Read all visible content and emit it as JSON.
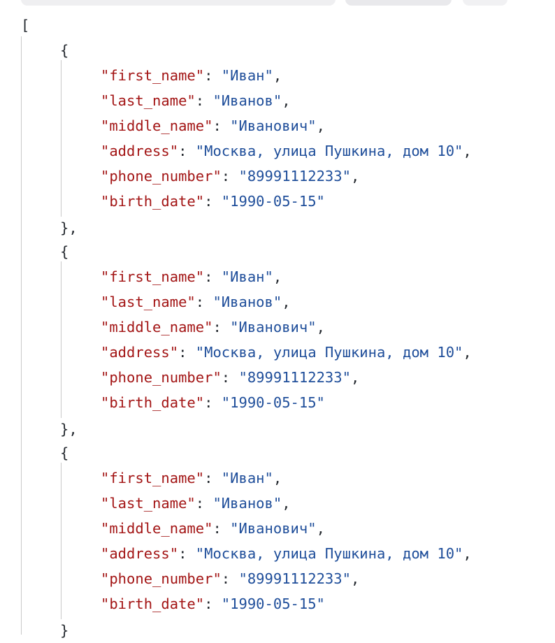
{
  "tabs": [
    "",
    "",
    ""
  ],
  "json": {
    "open_bracket": "[",
    "records": [
      {
        "open": "{",
        "close": "},",
        "fields": [
          {
            "key": "\"first_name\"",
            "value": "\"Иван\"",
            "trail": ","
          },
          {
            "key": "\"last_name\"",
            "value": "\"Иванов\"",
            "trail": ","
          },
          {
            "key": "\"middle_name\"",
            "value": "\"Иванович\"",
            "trail": ","
          },
          {
            "key": "\"address\"",
            "value": "\"Москва, улица Пушкина, дом 10\"",
            "trail": ","
          },
          {
            "key": "\"phone_number\"",
            "value": "\"89991112233\"",
            "trail": ","
          },
          {
            "key": "\"birth_date\"",
            "value": "\"1990-05-15\"",
            "trail": ""
          }
        ]
      },
      {
        "open": "{",
        "close": "},",
        "fields": [
          {
            "key": "\"first_name\"",
            "value": "\"Иван\"",
            "trail": ","
          },
          {
            "key": "\"last_name\"",
            "value": "\"Иванов\"",
            "trail": ","
          },
          {
            "key": "\"middle_name\"",
            "value": "\"Иванович\"",
            "trail": ","
          },
          {
            "key": "\"address\"",
            "value": "\"Москва, улица Пушкина, дом 10\"",
            "trail": ","
          },
          {
            "key": "\"phone_number\"",
            "value": "\"89991112233\"",
            "trail": ","
          },
          {
            "key": "\"birth_date\"",
            "value": "\"1990-05-15\"",
            "trail": ""
          }
        ]
      },
      {
        "open": "{",
        "close": "}",
        "fields": [
          {
            "key": "\"first_name\"",
            "value": "\"Иван\"",
            "trail": ","
          },
          {
            "key": "\"last_name\"",
            "value": "\"Иванов\"",
            "trail": ","
          },
          {
            "key": "\"middle_name\"",
            "value": "\"Иванович\"",
            "trail": ","
          },
          {
            "key": "\"address\"",
            "value": "\"Москва, улица Пушкина, дом 10\"",
            "trail": ","
          },
          {
            "key": "\"phone_number\"",
            "value": "\"89991112233\"",
            "trail": ","
          },
          {
            "key": "\"birth_date\"",
            "value": "\"1990-05-15\"",
            "trail": ""
          }
        ]
      }
    ]
  },
  "colors": {
    "key": "#a31515",
    "string": "#1f4e9a",
    "punctuation": "#24292f",
    "indent_guide": "#c9c9c9"
  }
}
